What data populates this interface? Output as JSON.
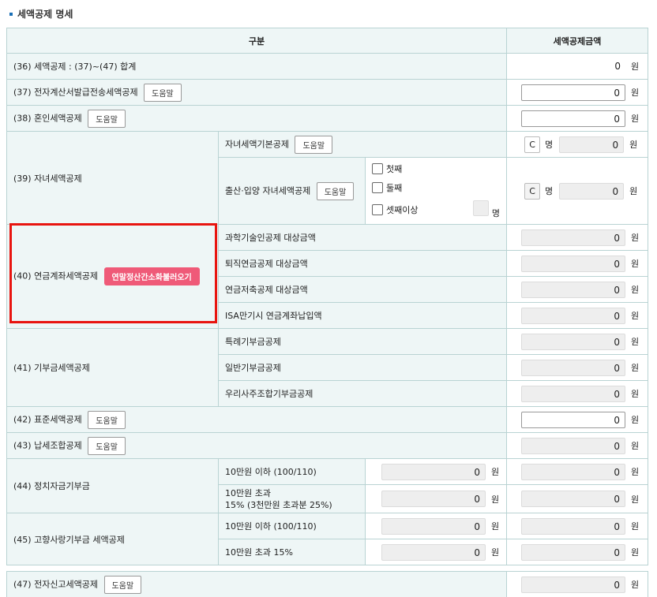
{
  "section_title": "세액공제 명세",
  "header": {
    "col1": "구분",
    "col2": "세액공제금액"
  },
  "unit": "원",
  "person_unit": "명",
  "help_label": "도움말",
  "rows": {
    "r36": {
      "label": "(36) 세액공제 : (37)~(47) 합계",
      "value": "0"
    },
    "r37": {
      "label": "(37) 전자계산서발급전송세액공제",
      "value": "0"
    },
    "r38": {
      "label": "(38) 혼인세액공제",
      "value": "0"
    },
    "r39": {
      "label": "(39) 자녀세액공제",
      "basic": {
        "label": "자녀세액기본공제",
        "count": "C",
        "value": "0"
      },
      "birth": {
        "label": "출산·입양 자녀세액공제",
        "checks": [
          "첫째",
          "둘째",
          "셋째이상"
        ],
        "count": "C",
        "value": "0"
      }
    },
    "r40": {
      "label": "(40) 연금계좌세액공제",
      "button": "연말정산간소화불러오기",
      "items": [
        {
          "label": "과학기술인공제 대상금액",
          "base": "0",
          "value": "0"
        },
        {
          "label": "퇴직연금공제 대상금액",
          "base": "0",
          "value": "0"
        },
        {
          "label": "연금저축공제 대상금액",
          "base": "0",
          "value": "0"
        },
        {
          "label": "ISA만기시 연금계좌납입액",
          "base": "0",
          "value": "0"
        }
      ]
    },
    "r41": {
      "label": "(41) 기부금세액공제",
      "items": [
        {
          "label": "특례기부금공제",
          "base": "0",
          "value": "0"
        },
        {
          "label": "일반기부금공제",
          "base": "0",
          "value": "0"
        },
        {
          "label": "우리사주조합기부금공제",
          "base": "0",
          "value": "0"
        }
      ]
    },
    "r42": {
      "label": "(42) 표준세액공제",
      "value": "0"
    },
    "r43": {
      "label": "(43) 납세조합공제",
      "value": "0"
    },
    "r44": {
      "label": "(44) 정치자금기부금",
      "items": [
        {
          "label": "10만원 이하 (100/110)",
          "base": "0",
          "value": "0"
        },
        {
          "label": "10만원 초과",
          "label2": "15% (3천만원 초과분 25%)",
          "base": "0",
          "value": "0"
        }
      ]
    },
    "r45": {
      "label": "(45) 고향사랑기부금 세액공제",
      "items": [
        {
          "label": "10만원 이하 (100/110)",
          "base": "0",
          "value": "0"
        },
        {
          "label": "10만원 초과 15%",
          "base": "0",
          "value": "0"
        }
      ]
    },
    "r47": {
      "label": "(47) 전자신고세액공제",
      "value": "0"
    }
  },
  "colors": {
    "label_bg": "#eef6f6",
    "border": "#b9d3d3",
    "pink_button": "#ef5a78",
    "highlight_box": "#e8140f"
  }
}
